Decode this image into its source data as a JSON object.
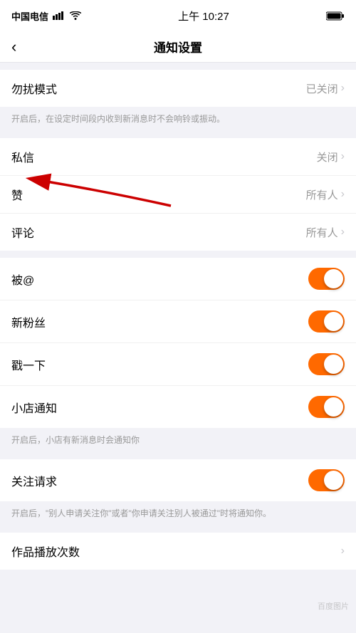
{
  "statusBar": {
    "carrier": "中国电信",
    "time": "上午 10:27",
    "battery": "100"
  },
  "navBar": {
    "backLabel": "‹",
    "title": "通知设置"
  },
  "sections": [
    {
      "id": "dnd",
      "items": [
        {
          "label": "勿扰模式",
          "value": "已关闭",
          "type": "chevron"
        }
      ],
      "desc": "开启后，在设定时间段内收到新消息时不会响铃或振动。"
    },
    {
      "id": "messages",
      "items": [
        {
          "label": "私信",
          "value": "关闭",
          "type": "chevron"
        },
        {
          "label": "赞",
          "value": "所有人",
          "type": "chevron",
          "hasArrow": true
        },
        {
          "label": "评论",
          "value": "所有人",
          "type": "chevron"
        }
      ],
      "desc": null
    },
    {
      "id": "toggles",
      "items": [
        {
          "label": "被@",
          "type": "toggle",
          "on": true
        },
        {
          "label": "新粉丝",
          "type": "toggle",
          "on": true
        },
        {
          "label": "戳一下",
          "type": "toggle",
          "on": true
        },
        {
          "label": "小店通知",
          "type": "toggle",
          "on": true,
          "desc": "开启后，小店有新消息时会通知你"
        }
      ],
      "desc": null
    },
    {
      "id": "follow",
      "items": [
        {
          "label": "关注请求",
          "type": "toggle",
          "on": true,
          "desc": "开启后，\"别人申请关注你\"或者\"你申请关注别人被通过\"时将通知你。"
        }
      ],
      "desc": null
    },
    {
      "id": "playcount",
      "items": [
        {
          "label": "作品播放次数",
          "value": "",
          "type": "chevron"
        }
      ],
      "desc": null
    }
  ],
  "watermark": "百度图片"
}
